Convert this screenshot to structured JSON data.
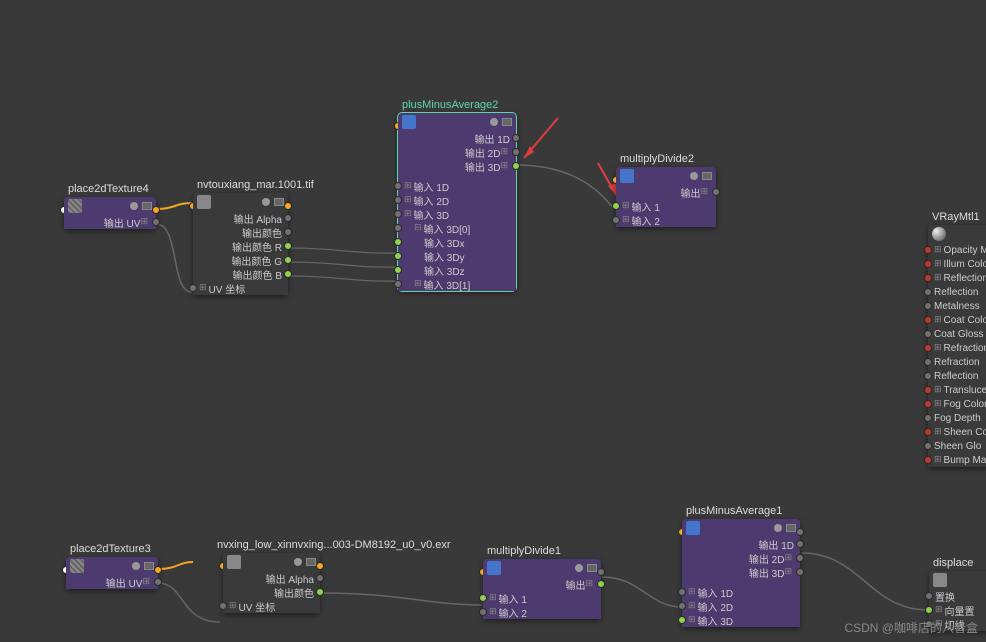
{
  "watermark": "CSDN @咖啡店的八音盒",
  "nodes": {
    "p2d4": {
      "title": "place2dTexture4",
      "outputs": [
        "输出 UV"
      ]
    },
    "p2d3": {
      "title": "place2dTexture3",
      "outputs": [
        "输出 UV"
      ]
    },
    "file1": {
      "title": "nvtouxiang_mar.1001.tif",
      "outputs": [
        "输出 Alpha",
        "输出颜色",
        "输出颜色 R",
        "输出颜色 G",
        "输出颜色 B"
      ],
      "inputs": [
        "UV 坐标"
      ]
    },
    "file2": {
      "title": "nvxing_low_xinnvxing...003-DM8192_u0_v0.exr",
      "outputs": [
        "输出 Alpha",
        "输出颜色"
      ],
      "inputs": [
        "UV 坐标"
      ]
    },
    "pma2": {
      "title": "plusMinusAverage2",
      "outputs": [
        "输出 1D",
        "输出 2D",
        "输出 3D"
      ],
      "inputs": [
        "输入 1D",
        "输入 2D",
        "输入 3D",
        "输入 3D[0]",
        "输入 3Dx",
        "输入 3Dy",
        "输入 3Dz",
        "输入 3D[1]"
      ]
    },
    "pma1": {
      "title": "plusMinusAverage1",
      "outputs": [
        "输出 1D",
        "输出 2D",
        "输出 3D"
      ],
      "inputs": [
        "输入 1D",
        "输入 2D",
        "输入 3D"
      ]
    },
    "md2": {
      "title": "multiplyDivide2",
      "outputs": [
        "输出"
      ],
      "inputs": [
        "输入 1",
        "输入 2"
      ]
    },
    "md1": {
      "title": "multiplyDivide1",
      "outputs": [
        "输出"
      ],
      "inputs": [
        "输入 1",
        "输入 2"
      ]
    },
    "vray": {
      "title": "VRayMtl1",
      "attrs": [
        "Opacity M",
        "Illum Colo",
        "Reflection",
        "Reflection",
        "Metalness",
        "Coat Color",
        "Coat Gloss",
        "Refraction",
        "Refraction",
        "Reflection",
        "Translucen",
        "Fog Color",
        "Fog Depth",
        "Sheen Col",
        "Sheen Glo",
        "Bump Map"
      ]
    },
    "disp": {
      "title": "displace",
      "attrs": [
        "置换",
        "向量置",
        "切线"
      ]
    }
  }
}
